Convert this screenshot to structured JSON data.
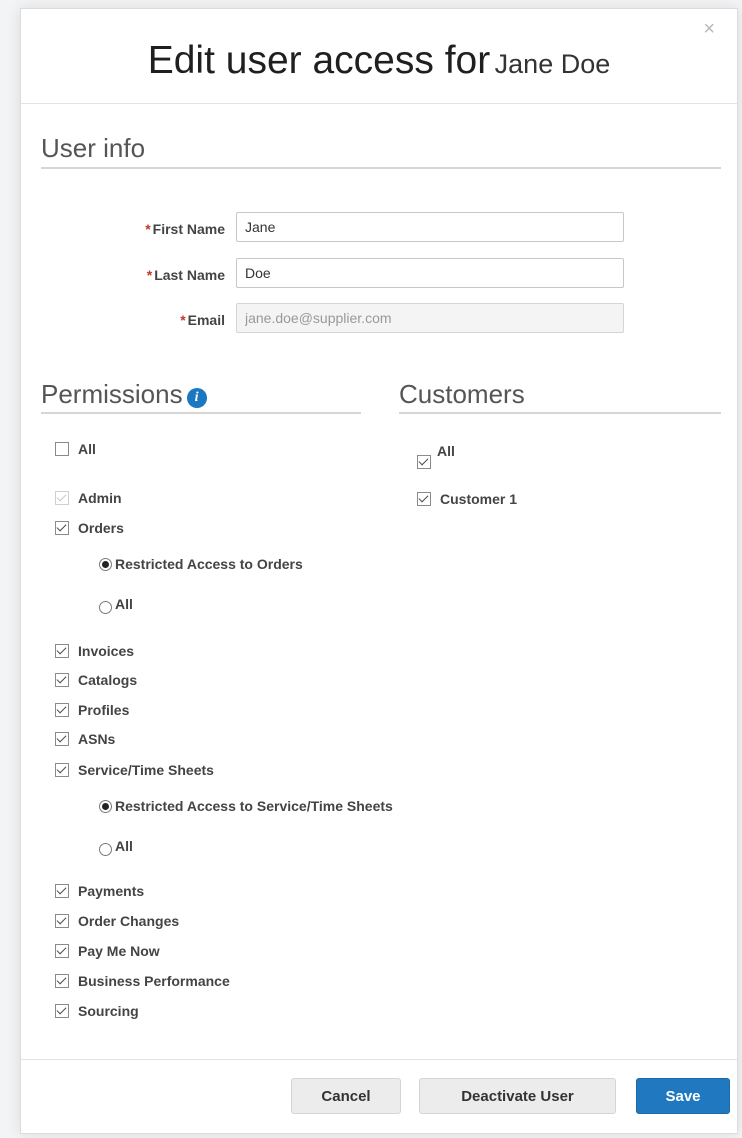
{
  "dialog": {
    "close_glyph": "×",
    "title": "Edit user access for",
    "user_name": "Jane Doe"
  },
  "user_info": {
    "heading": "User info",
    "required_marker": "*",
    "first_name_label": "First Name",
    "first_name_value": "Jane",
    "last_name_label": "Last Name",
    "last_name_value": "Doe",
    "email_label": "Email",
    "email_value": "jane.doe@supplier.com"
  },
  "permissions": {
    "heading": "Permissions",
    "info_glyph": "i",
    "items": [
      {
        "label": "All",
        "checked": false
      },
      {
        "label": "Admin",
        "checked": true,
        "disabled": true
      },
      {
        "label": "Orders",
        "checked": true
      },
      {
        "label": "Restricted Access to Orders",
        "type": "radio",
        "checked": true
      },
      {
        "label": "All",
        "type": "radio",
        "checked": false
      },
      {
        "label": "Invoices",
        "checked": true
      },
      {
        "label": "Catalogs",
        "checked": true
      },
      {
        "label": "Profiles",
        "checked": true
      },
      {
        "label": "ASNs",
        "checked": true
      },
      {
        "label": "Service/Time Sheets",
        "checked": true
      },
      {
        "label": "Restricted Access to Service/Time Sheets",
        "type": "radio",
        "checked": true
      },
      {
        "label": "All",
        "type": "radio",
        "checked": false
      },
      {
        "label": "Payments",
        "checked": true
      },
      {
        "label": "Order Changes",
        "checked": true
      },
      {
        "label": "Pay Me Now",
        "checked": true
      },
      {
        "label": "Business Performance",
        "checked": true
      },
      {
        "label": "Sourcing",
        "checked": true
      }
    ]
  },
  "customers": {
    "heading": "Customers",
    "items": [
      {
        "label": "All",
        "checked": true
      },
      {
        "label": "Customer 1",
        "checked": true
      }
    ]
  },
  "footer": {
    "cancel_label": "Cancel",
    "deactivate_label": "Deactivate User",
    "save_label": "Save"
  },
  "colors": {
    "primary": "#1f78c0",
    "required": "#c0392b",
    "info_icon": "#1b77c0"
  }
}
